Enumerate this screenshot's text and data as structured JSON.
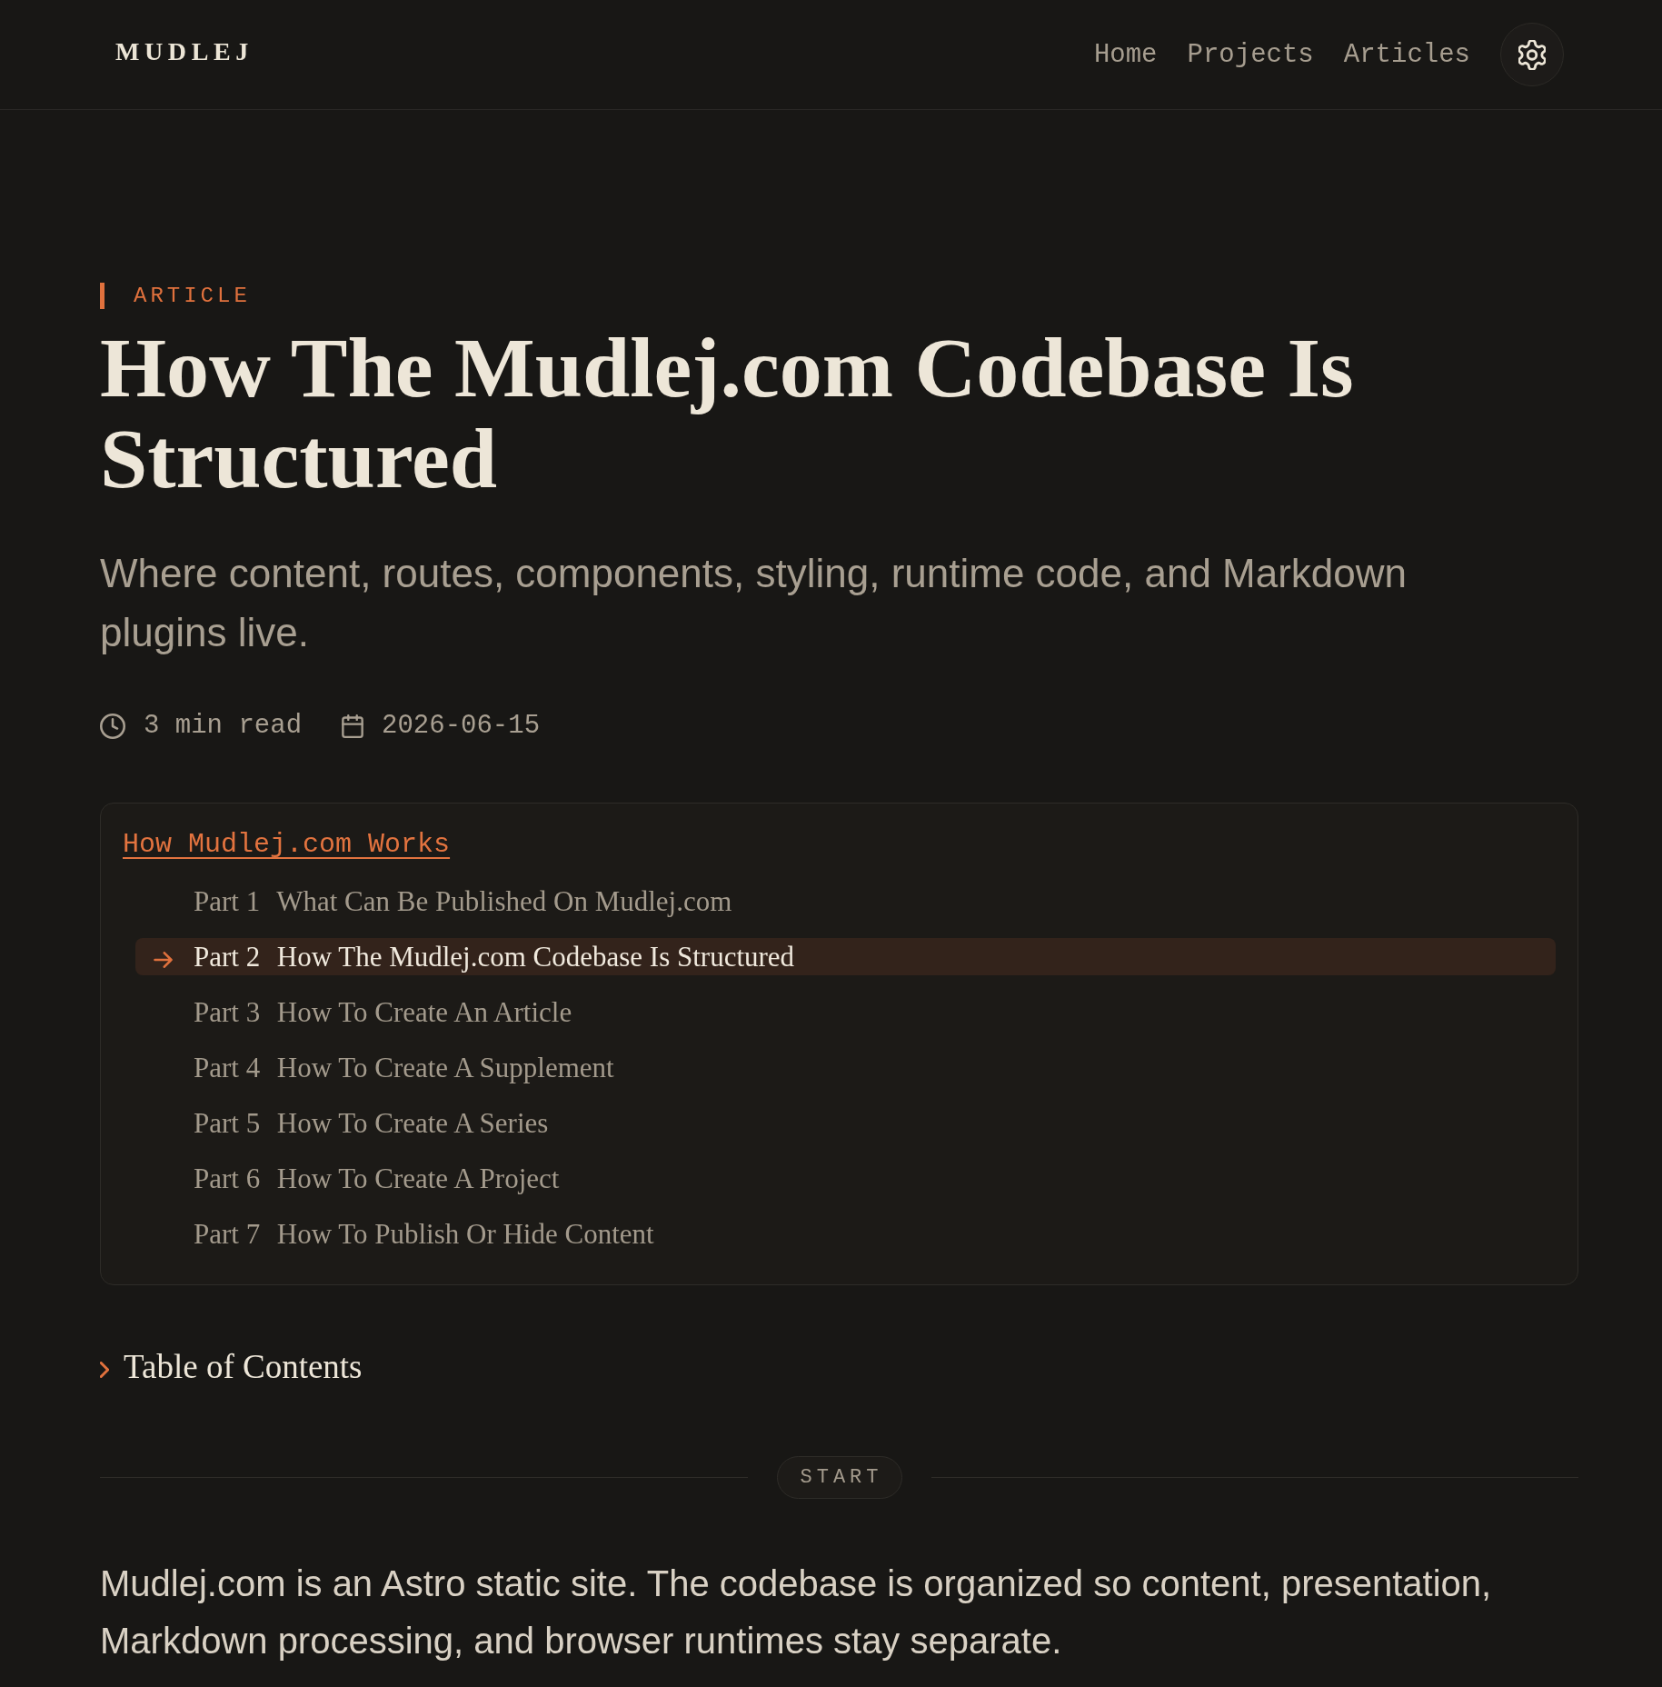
{
  "header": {
    "logo": "MUDLEJ",
    "nav": [
      {
        "label": "Home"
      },
      {
        "label": "Projects"
      },
      {
        "label": "Articles"
      }
    ]
  },
  "article": {
    "kicker": "ARTICLE",
    "title": "How The Mudlej.com Codebase Is Structured",
    "subtitle": "Where content, routes, components, styling, runtime code, and Markdown plugins live.",
    "meta": [
      {
        "kind": "reading_time",
        "text": "3 min read"
      },
      {
        "kind": "date",
        "text": "2026-06-15"
      }
    ]
  },
  "series": {
    "title": "How Mudlej.com Works",
    "parts": [
      {
        "label": "Part 1",
        "title": "What Can Be Published On Mudlej.com",
        "selected": false
      },
      {
        "label": "Part 2",
        "title": "How The Mudlej.com Codebase Is Structured",
        "selected": true
      },
      {
        "label": "Part 3",
        "title": "How To Create An Article",
        "selected": false
      },
      {
        "label": "Part 4",
        "title": "How To Create A Supplement",
        "selected": false
      },
      {
        "label": "Part 5",
        "title": "How To Create A Series",
        "selected": false
      },
      {
        "label": "Part 6",
        "title": "How To Create A Project",
        "selected": false
      },
      {
        "label": "Part 7",
        "title": "How To Publish Or Hide Content",
        "selected": false
      }
    ]
  },
  "toc": {
    "label": "Table of Contents",
    "expanded": false
  },
  "divider": {
    "label": "START"
  },
  "body": [
    "Mudlej.com is an Astro static site. The codebase is organized so content, presentation, Markdown processing, and browser runtimes stay separate."
  ]
}
